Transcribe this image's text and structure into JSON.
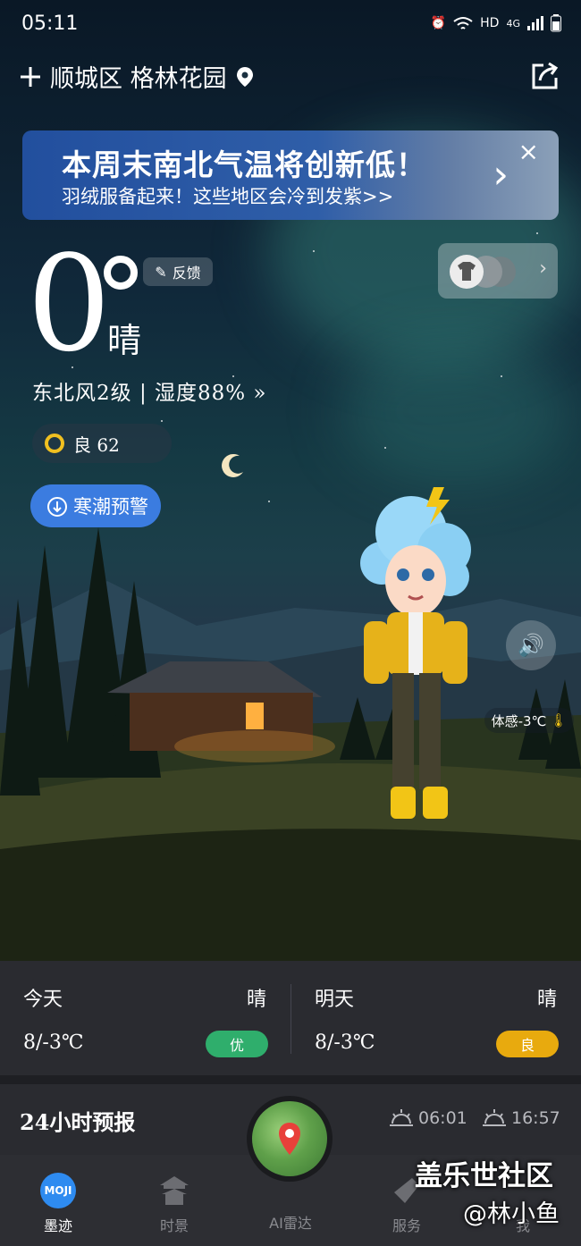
{
  "status_bar": {
    "time": "05:11",
    "hd": "HD",
    "network": "4G"
  },
  "header": {
    "location": "顺城区 格林花园"
  },
  "banner": {
    "title": "本周末南北气温将创新低！",
    "subtitle": "羽绒服备起来！这些地区会冷到发紫>>"
  },
  "current": {
    "temperature": "0",
    "condition": "晴",
    "feedback_label": "反馈",
    "wind_humidity": "东北风2级 | 湿度88% »",
    "aqi_label": "良 62",
    "alert_label": "寒潮预警",
    "feels_like": "体感-3℃"
  },
  "forecast": {
    "today": {
      "label": "今天",
      "condition": "晴",
      "range": "8/-3℃",
      "aqi": "优",
      "aqi_color": "#2fae6c"
    },
    "tomorrow": {
      "label": "明天",
      "condition": "晴",
      "range": "8/-3℃",
      "aqi": "良",
      "aqi_color": "#e8aa0e"
    }
  },
  "hourly": {
    "title": "24小时预报",
    "sunrise": "06:01",
    "sunset": "16:57"
  },
  "nav": {
    "items": [
      {
        "label": "墨迹",
        "logo": "MOJI"
      },
      {
        "label": "时景"
      },
      {
        "label": "AI雷达"
      },
      {
        "label": "服务"
      },
      {
        "label": "我"
      }
    ]
  },
  "watermark": {
    "line1": "盖乐世社区",
    "line2": "@林小鱼"
  }
}
